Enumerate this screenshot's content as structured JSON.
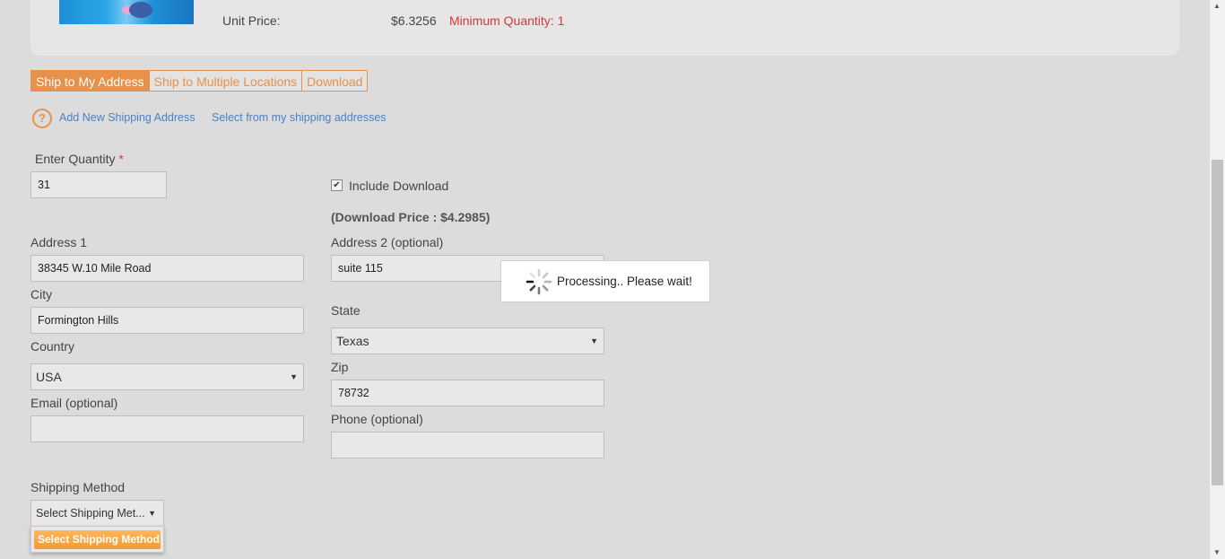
{
  "product": {
    "unit_price_label": "Unit Price:",
    "unit_price_value": "$6.3256",
    "minimum_quantity": "Minimum Quantity: 1"
  },
  "tabs": [
    {
      "label": "Ship to My Address",
      "active": true
    },
    {
      "label": "Ship to Multiple Locations",
      "active": false
    },
    {
      "label": "Download",
      "active": false
    }
  ],
  "address_links": {
    "help_glyph": "?",
    "add_new": "Add New Shipping Address",
    "select_existing": "Select from my shipping addresses"
  },
  "form": {
    "quantity_label": "Enter Quantity",
    "required_mark": "*",
    "quantity_value": "31",
    "include_download_label": "Include Download",
    "include_download_checked": true,
    "download_price": "(Download Price : $4.2985)",
    "address1_label": "Address 1",
    "address1_value": "38345 W.10 Mile Road",
    "address2_label": "Address 2 (optional)",
    "address2_value": "suite 115",
    "city_label": "City",
    "city_value": "Formington Hills",
    "state_label": "State",
    "state_value": "Texas",
    "country_label": "Country",
    "country_value": "USA",
    "zip_label": "Zip",
    "zip_value": "78732",
    "email_label": "Email (optional)",
    "email_value": "",
    "phone_label": "Phone (optional)",
    "phone_value": "",
    "shipping_method_label": "Shipping Method",
    "shipping_method_value": "Select Shipping Met...",
    "shipping_method_option": "Select Shipping Method"
  },
  "overlay": {
    "processing_text": "Processing.. Please wait!"
  },
  "colors": {
    "accent": "#e8914a",
    "link": "#4a82c2",
    "error": "#d9363e",
    "option_highlight": "#f39a30"
  },
  "icons": {
    "help": "help-circle-icon",
    "spinner": "loading-spinner-icon",
    "caret": "caret-down-icon",
    "check": "checkmark-icon"
  }
}
